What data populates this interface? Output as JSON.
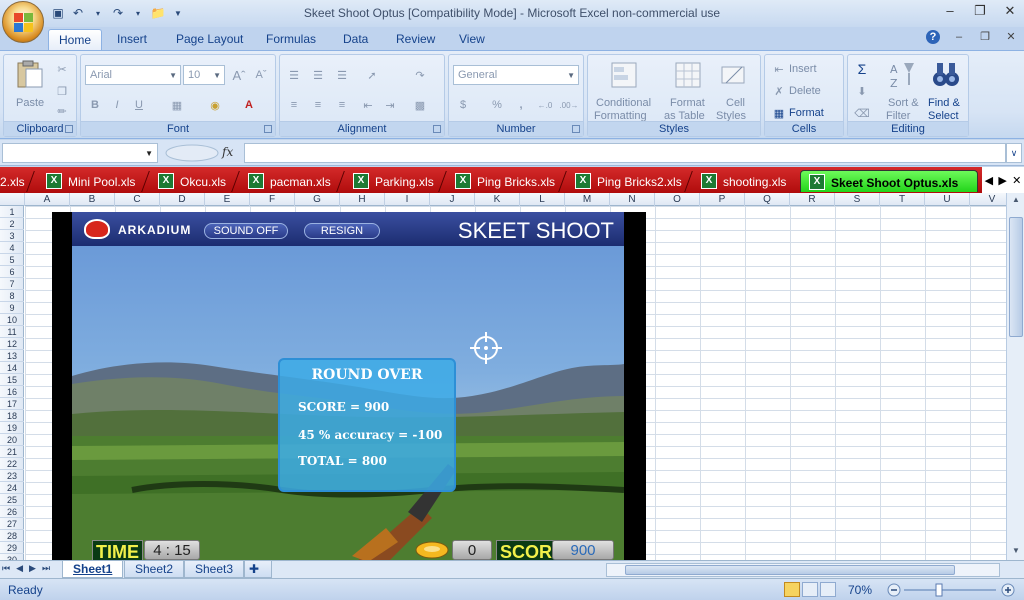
{
  "window": {
    "title": "Skeet Shoot Optus  [Compatibility Mode] - Microsoft Excel non-commercial use"
  },
  "ribbon_tabs": [
    "Home",
    "Insert",
    "Page Layout",
    "Formulas",
    "Data",
    "Review",
    "View"
  ],
  "ribbon": {
    "clipboard": {
      "paste": "Paste",
      "label": "Clipboard"
    },
    "font": {
      "name": "Arial",
      "size": "10",
      "label": "Font"
    },
    "alignment": {
      "label": "Alignment"
    },
    "number": {
      "format": "General",
      "label": "Number",
      "currency": "$",
      "percent": "%",
      "comma": ",",
      "inc_decimal": ".0→.00",
      "dec_decimal": ".00→.0"
    },
    "styles": {
      "conditional_1": "Conditional",
      "conditional_2": "Formatting",
      "format_table_1": "Format",
      "format_table_2": "as Table",
      "cell_styles_1": "Cell",
      "cell_styles_2": "Styles",
      "label": "Styles"
    },
    "cells": {
      "insert": "Insert",
      "delete": "Delete",
      "format": "Format",
      "label": "Cells"
    },
    "editing": {
      "sort_1": "Sort &",
      "sort_2": "Filter",
      "find_1": "Find &",
      "find_2": "Select",
      "label": "Editing"
    }
  },
  "formula_bar": {
    "fx": "fx",
    "value": ""
  },
  "workbook_tabs": [
    {
      "label": "2.xls",
      "active": false
    },
    {
      "label": "Mini Pool.xls",
      "active": false
    },
    {
      "label": "Okcu.xls",
      "active": false
    },
    {
      "label": "pacman.xls",
      "active": false
    },
    {
      "label": "Parking.xls",
      "active": false
    },
    {
      "label": "Ping Bricks.xls",
      "active": false
    },
    {
      "label": "Ping Bricks2.xls",
      "active": false
    },
    {
      "label": "shooting.xls",
      "active": false
    },
    {
      "label": "Skeet Shoot Optus.xls",
      "active": true
    }
  ],
  "columns": [
    "A",
    "B",
    "C",
    "D",
    "E",
    "F",
    "G",
    "H",
    "I",
    "J",
    "K",
    "L",
    "M",
    "N",
    "O",
    "P",
    "Q",
    "R",
    "S",
    "T",
    "U",
    "V"
  ],
  "rows": [
    "1",
    "2",
    "3",
    "4",
    "5",
    "6",
    "7",
    "8",
    "9",
    "10",
    "11",
    "12",
    "13",
    "14",
    "15",
    "16",
    "17",
    "18",
    "19",
    "20",
    "21",
    "22",
    "23",
    "24",
    "25",
    "26",
    "27",
    "28",
    "29",
    "30"
  ],
  "game": {
    "brand": "ARKADIUM",
    "sound_button": "SOUND OFF",
    "resign_button": "RESIGN",
    "title": "SKEET SHOOT",
    "popup": {
      "title": "ROUND OVER",
      "score": "SCORE = 900",
      "accuracy": "45 % accuracy = -100",
      "total": "TOTAL = 800"
    },
    "hud": {
      "time_label": "TIME",
      "time_value": "4 : 15",
      "targets_value": "0",
      "score_label": "SCORE",
      "score_value": "900"
    }
  },
  "sheets": [
    {
      "label": "Sheet1",
      "active": true
    },
    {
      "label": "Sheet2",
      "active": false
    },
    {
      "label": "Sheet3",
      "active": false
    }
  ],
  "status": {
    "ready": "Ready",
    "zoom": "70%"
  }
}
